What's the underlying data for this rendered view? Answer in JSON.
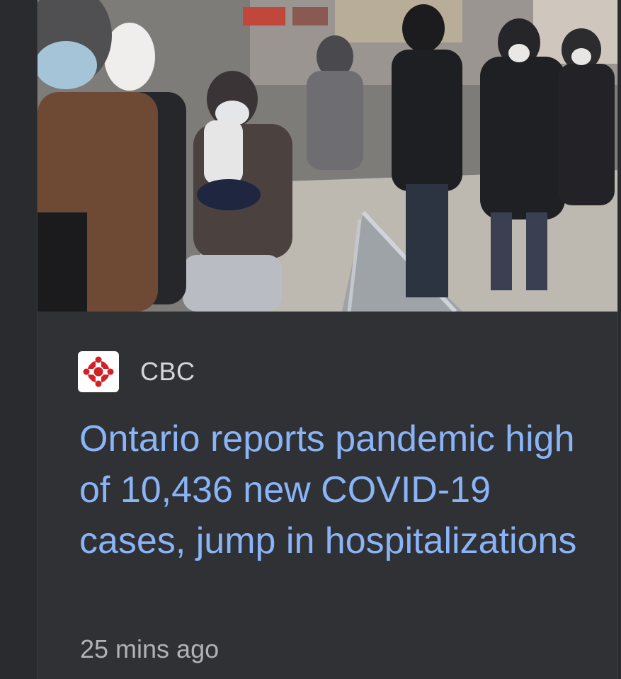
{
  "article": {
    "image_description_icon": "photo-thumbnail",
    "source": {
      "name": "CBC",
      "logo_icon": "cbc-gem-logo",
      "logo_color": "#d32027"
    },
    "headline": "Ontario reports pandemic high of 10,436 new COVID-19 cases, jump in hospitalizations",
    "timestamp": "25 mins ago"
  },
  "colors": {
    "headline": "#8ab4f8",
    "card_background": "#303134",
    "page_background": "#2a2b2f",
    "source_text": "#d5d6d9",
    "timestamp_text": "#b0b2b6"
  }
}
